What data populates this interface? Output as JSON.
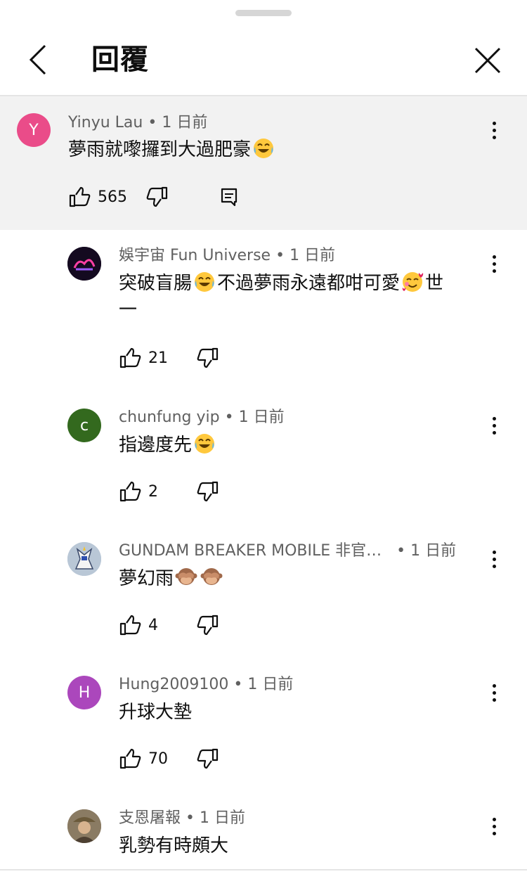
{
  "header": {
    "title": "回覆"
  },
  "parent": {
    "avatar_letter": "Y",
    "author": "Yinyu Lau",
    "time": "• 1 日前",
    "text": "夢雨就嚟攞到大過肥豪",
    "likes": "565"
  },
  "replies": [
    {
      "author": "娛宇宙 Fun Universe",
      "time": "• 1 日前",
      "text_line1": "突破盲腸",
      "text_line1b": "不過夢雨永遠都咁可愛",
      "text_line1c": "世",
      "text_line2": "一",
      "likes": "21"
    },
    {
      "avatar_letter": "c",
      "author": "chunfung yip",
      "time": "• 1 日前",
      "text": "指邊度先",
      "likes": "2"
    },
    {
      "author": "GUNDAM BREAKER MOBILE 非官…",
      "time": "• 1 日前",
      "text": "夢幻雨",
      "likes": "4"
    },
    {
      "avatar_letter": "H",
      "author": "Hung2009100",
      "time": "• 1 日前",
      "text": "升球大墊",
      "likes": "70"
    },
    {
      "author": "支恩屠報",
      "time": "• 1 日前",
      "text": "乳勢有時頗大"
    }
  ],
  "colors": {
    "avatar_y": "#ea4c89",
    "avatar_c": "#33691e",
    "avatar_h": "#ab47bc",
    "highlight_bg": "#f2f2f2"
  },
  "icons": {
    "back": "chevron-left-icon",
    "close": "close-icon",
    "like": "thumb-up-icon",
    "dislike": "thumb-down-icon",
    "reply": "comment-icon",
    "more": "more-vertical-icon",
    "emoji_joy": "face-with-tears-of-joy-icon",
    "emoji_hearts": "smiling-face-with-hearts-icon",
    "emoji_monkey": "see-no-evil-monkey-icon"
  }
}
